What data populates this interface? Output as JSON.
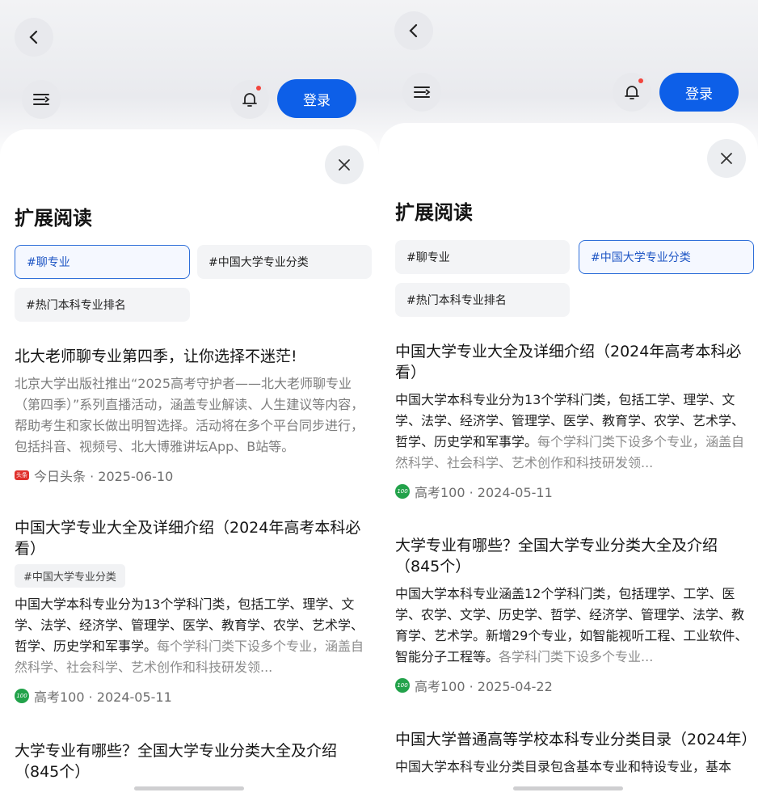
{
  "login_label": "登录",
  "sheet_title": "扩展阅读",
  "left": {
    "chips": [
      "#聊专业",
      "#中国大学专业分类",
      "#热门本科专业排名"
    ],
    "articles": [
      {
        "title": "北大老师聊专业第四季，让你选择不迷茫!",
        "body": "北京大学出版社推出“2025高考守护者——北大老师聊专业（第四季）”系列直播活动，涵盖专业解读、人生建议等内容，帮助考生和家长做出明智选择。活动将在多个平台同步进行，包括抖音、视频号、北大博雅讲坛App、B站等。",
        "source_icon": "头条",
        "source": "今日头条 · 2025-06-10"
      },
      {
        "title": "中国大学专业大全及详细介绍（2024年高考本科必看）",
        "tag": "#中国大学专业分类",
        "body": "中国大学本科专业分为13个学科门类，包括工学、理学、文学、法学、经济学、管理学、医学、教育学、农学、艺术学、哲学、历史学和军事学。",
        "body_more": "每个学科门类下设多个专业，涵盖自然科学、社会科学、艺术创作和科技研发领...",
        "source_icon": "100",
        "source": "高考100 · 2024-05-11"
      },
      {
        "title": "大学专业有哪些？全国大学专业分类大全及介绍（845个）"
      }
    ]
  },
  "right": {
    "chips": [
      "#聊专业",
      "#中国大学专业分类",
      "#热门本科专业排名"
    ],
    "articles": [
      {
        "title": "中国大学专业大全及详细介绍（2024年高考本科必看）",
        "body": "中国大学本科专业分为13个学科门类，包括工学、理学、文学、法学、经济学、管理学、医学、教育学、农学、艺术学、哲学、历史学和军事学。",
        "body_more": "每个学科门类下设多个专业，涵盖自然科学、社会科学、艺术创作和科技研发领...",
        "source_icon": "100",
        "source": "高考100 · 2024-05-11"
      },
      {
        "title": "大学专业有哪些？全国大学专业分类大全及介绍（845个）",
        "body": "中国大学本科专业涵盖12个学科门类，包括理学、工学、医学、农学、文学、历史学、哲学、经济学、管理学、法学、教育学、艺术学。新增29个专业，如智能视听工程、工业软件、智能分子工程等。",
        "body_more": "各学科门类下设多个专业...",
        "source_icon": "100",
        "source": "高考100 · 2025-04-22"
      },
      {
        "title": "中国大学普通高等学校本科专业分类目录（2024年）",
        "body": "中国大学本科专业分类目录包含基本专业和特设专业，基本"
      }
    ]
  }
}
